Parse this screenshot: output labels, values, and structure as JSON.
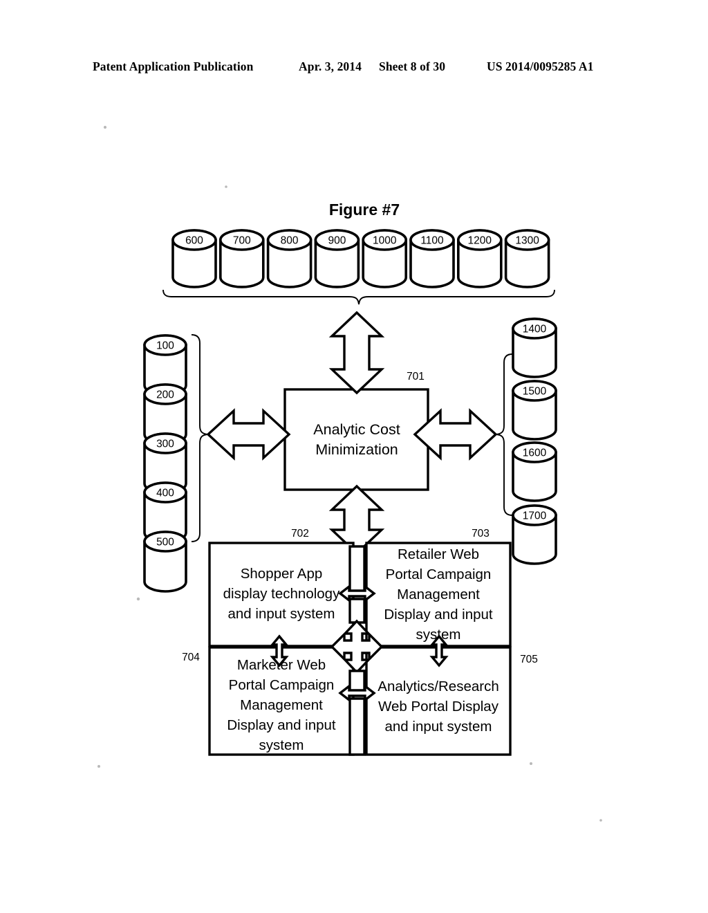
{
  "header": {
    "publication": "Patent Application Publication",
    "date": "Apr. 3, 2014",
    "sheet": "Sheet 8 of 30",
    "patent_number": "US 2014/0095285 A1"
  },
  "figure": {
    "title": "Figure #7",
    "top_databases": [
      {
        "label": "600"
      },
      {
        "label": "700"
      },
      {
        "label": "800"
      },
      {
        "label": "900"
      },
      {
        "label": "1000"
      },
      {
        "label": "1100"
      },
      {
        "label": "1200"
      },
      {
        "label": "1300"
      }
    ],
    "left_databases": [
      {
        "label": "100"
      },
      {
        "label": "200"
      },
      {
        "label": "300"
      },
      {
        "label": "400"
      },
      {
        "label": "500"
      }
    ],
    "right_databases": [
      {
        "label": "1400"
      },
      {
        "label": "1500"
      },
      {
        "label": "1600"
      },
      {
        "label": "1700"
      }
    ],
    "center_box": {
      "ref": "701",
      "line1": "Analytic  Cost",
      "line2": "Minimization"
    },
    "boxes": [
      {
        "ref": "702",
        "lines": [
          "Shopper App",
          "display technology",
          "and input system"
        ]
      },
      {
        "ref": "703",
        "lines": [
          "Retailer Web",
          "Portal Campaign",
          "Management",
          "Display and input",
          "system"
        ]
      },
      {
        "ref": "704",
        "lines": [
          "Marketer Web",
          "Portal Campaign",
          "Management",
          "Display and input",
          "system"
        ]
      },
      {
        "ref": "705",
        "lines": [
          "Analytics/Research",
          "Web Portal Display",
          "and input system"
        ]
      }
    ]
  },
  "colors": {
    "ink": "#000000",
    "paper": "#ffffff"
  }
}
